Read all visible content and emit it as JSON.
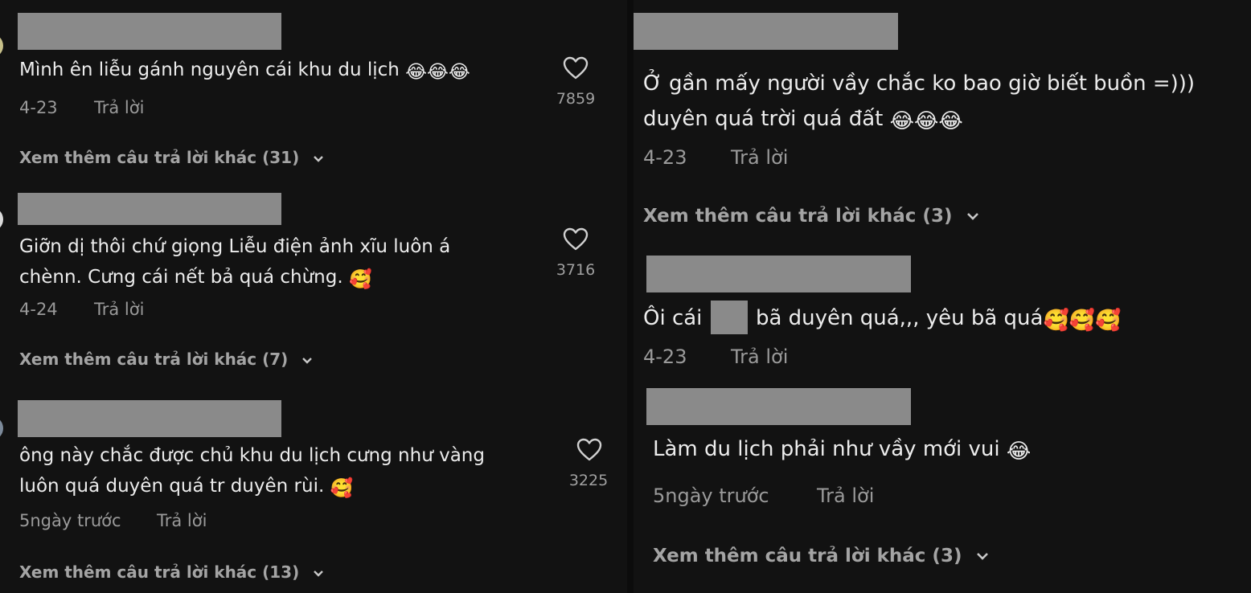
{
  "left": {
    "comments": [
      {
        "lines": [
          "Mình ên liễu gánh nguyên cái khu du lịch"
        ],
        "emoji_suffix": "😂😂😂",
        "date": "4-23",
        "reply": "Trả lời",
        "likes": "7859",
        "more": "Xem thêm câu trả lời khác (31)"
      },
      {
        "lines": [
          "Giỡn dị thôi chứ giọng Liễu điện ảnh xĩu luôn á",
          "chènn. Cưng cái nết bả quá chừng."
        ],
        "emoji_suffix": "🥰",
        "date": "4-24",
        "reply": "Trả lời",
        "likes": "3716",
        "more": "Xem thêm câu trả lời khác (7)"
      },
      {
        "lines": [
          "ông này chắc được chủ khu du lịch cưng như vàng",
          "luôn quá duyên quá tr duyên rùi."
        ],
        "emoji_suffix": "🥰",
        "date": "5ngày trước",
        "reply": "Trả lời",
        "likes": "3225",
        "more": "Xem thêm câu trả lời khác (13)"
      }
    ]
  },
  "right": {
    "comments": [
      {
        "lines": [
          "Ở gần mấy người vầy chắc ko bao giờ biết buồn =)))",
          "duyên quá trời quá đất"
        ],
        "emoji_suffix": "😂😂😂",
        "date": "4-23",
        "reply": "Trả lời",
        "more": "Xem thêm câu trả lời khác (3)"
      },
      {
        "prefix": "Ôi cái",
        "suffix": "bã duyên quá,,, yêu bã quá",
        "emoji_suffix": "🥰🥰🥰",
        "date": "4-23",
        "reply": "Trả lời"
      },
      {
        "lines": [
          "Làm du lịch phải như vầy mới vui"
        ],
        "emoji_suffix": "😂",
        "date": "5ngày trước",
        "reply": "Trả lời",
        "more": "Xem thêm câu trả lời khác (3)"
      }
    ]
  },
  "colors": {
    "background": "#121212",
    "redaction": "#8a8a8a",
    "text": "#ececec",
    "muted": "#9a9a9a"
  },
  "icons": [
    "heart-icon",
    "chevron-down-icon"
  ]
}
